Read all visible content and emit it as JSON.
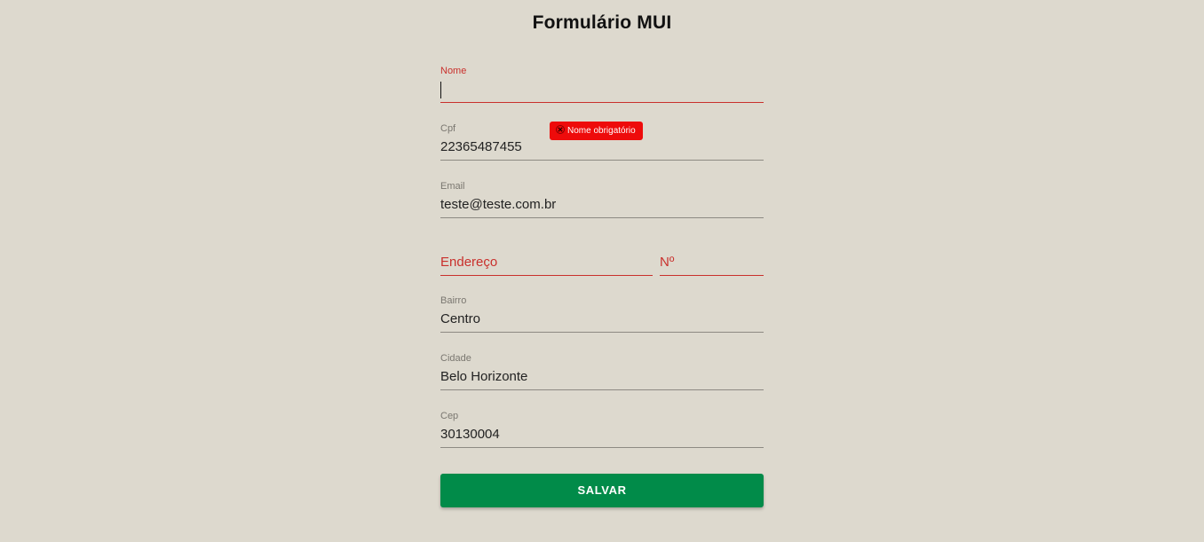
{
  "form": {
    "title": "Formulário MUI",
    "fields": {
      "nome": {
        "label": "Nome",
        "value": ""
      },
      "cpf": {
        "label": "Cpf",
        "value": "22365487455"
      },
      "email": {
        "label": "Email",
        "value": "teste@teste.com.br"
      },
      "endereco": {
        "label": "Endereço",
        "value": ""
      },
      "numero": {
        "label": "Nº",
        "value": ""
      },
      "bairro": {
        "label": "Bairro",
        "value": "Centro"
      },
      "cidade": {
        "label": "Cidade",
        "value": "Belo Horizonte"
      },
      "cep": {
        "label": "Cep",
        "value": "30130004"
      }
    },
    "error_tooltip": {
      "icon": "close-x-icon",
      "text": "Nome obrigatório"
    },
    "save_label": "SALVAR"
  },
  "colors": {
    "background": "#ddd9ce",
    "error": "#c9302c",
    "tooltip": "#ee0b0b",
    "button": "#018b49"
  }
}
